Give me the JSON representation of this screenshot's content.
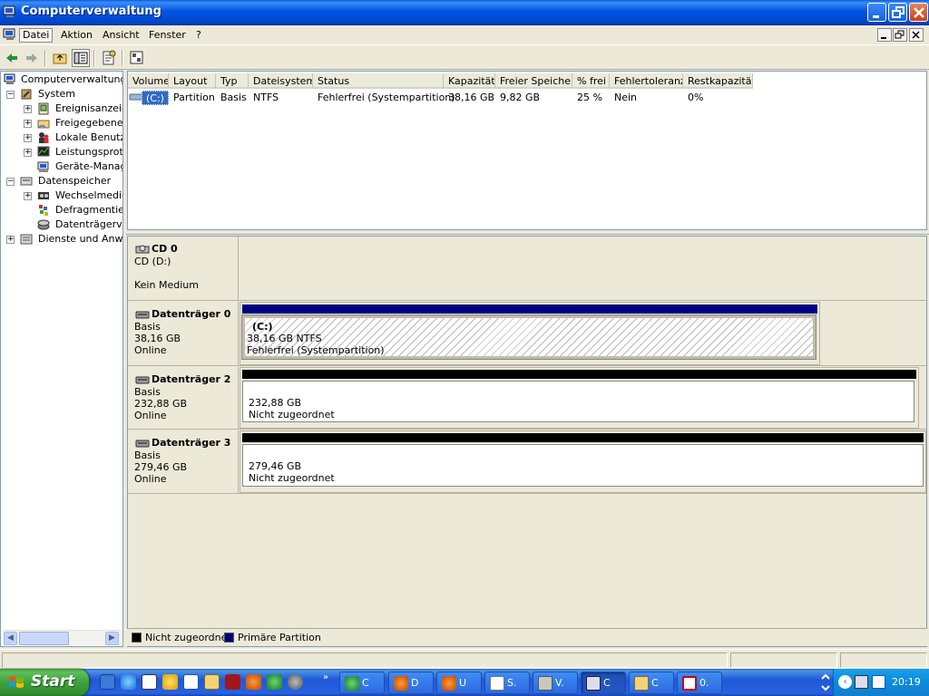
{
  "window": {
    "title": "Computerverwaltung",
    "controls": {
      "minimize": "minimize",
      "maximize": "maximize",
      "close": "close"
    }
  },
  "menu": {
    "items": [
      "Datei",
      "Aktion",
      "Ansicht",
      "Fenster",
      "?"
    ]
  },
  "tree": {
    "root": "Computerverwaltung (l",
    "system": "System",
    "system_children": [
      "Ereignisanzeige",
      "Freigegebene (",
      "Lokale Benutze",
      "Leistungsproto",
      "Geräte-Manage"
    ],
    "storage": "Datenspeicher",
    "storage_children": [
      "Wechselmedier",
      "Defragmentieru",
      "Datenträgerve"
    ],
    "services": "Dienste und Anwer"
  },
  "volume_table": {
    "columns": [
      "Volume",
      "Layout",
      "Typ",
      "Dateisystem",
      "Status",
      "Kapazität",
      "Freier Speicher",
      "% frei",
      "Fehlertoleranz",
      "Restkapazität"
    ],
    "rows": [
      [
        "(C:)",
        "Partition",
        "Basis",
        "NTFS",
        "Fehlerfrei (Systempartition)",
        "38,16 GB",
        "9,82 GB",
        "25 %",
        "Nein",
        "0%"
      ]
    ]
  },
  "disks": [
    {
      "name": "CD 0",
      "line1": "CD (D:)",
      "line2": "",
      "line3": "Kein Medium"
    },
    {
      "name": "Datenträger 0",
      "line1": "Basis",
      "line2": "38,16 GB",
      "line3": "Online",
      "partition": {
        "title": "(C:)",
        "size": "38,16 GB NTFS",
        "status": "Fehlerfrei (Systempartition)"
      }
    },
    {
      "name": "Datenträger 2",
      "line1": "Basis",
      "line2": "232,88 GB",
      "line3": "Online",
      "partition": {
        "size": "232,88 GB",
        "status": "Nicht zugeordnet"
      }
    },
    {
      "name": "Datenträger 3",
      "line1": "Basis",
      "line2": "279,46 GB",
      "line3": "Online",
      "partition": {
        "size": "279,46 GB",
        "status": "Nicht zugeordnet"
      }
    }
  ],
  "legend": {
    "unallocated": "Nicht zugeordnet",
    "primary": "Primäre Partition",
    "unallocated_color": "#000000",
    "primary_color": "#00007F"
  },
  "taskbar": {
    "start": "Start",
    "buttons": [
      "C",
      "D",
      "U",
      "S.",
      "V.",
      "C",
      "C",
      "0."
    ],
    "clock": "20:19"
  }
}
